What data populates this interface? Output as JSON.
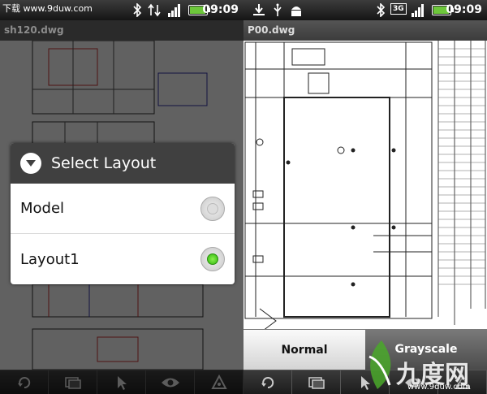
{
  "left_screen": {
    "status": {
      "time": "09:09",
      "watermark": "下载 www.9duw.com"
    },
    "title": "sh120.dwg",
    "dialog": {
      "title": "Select Layout",
      "options": [
        {
          "label": "Model",
          "selected": false
        },
        {
          "label": "Layout1",
          "selected": true
        }
      ]
    }
  },
  "right_screen": {
    "status": {
      "time": "09:09",
      "network": "3G"
    },
    "title": "P00.dwg",
    "modes": {
      "normal": "Normal",
      "grayscale": "Grayscale",
      "active": "Grayscale"
    }
  },
  "toolbar_icons": [
    "rotate-icon",
    "layers-icon",
    "pointer-icon",
    "eye-icon",
    "measure-icon"
  ],
  "logo": {
    "brand": "九度网",
    "site": "www.9duw.com"
  },
  "colors": {
    "accent_green": "#3ac21a",
    "dialog_header": "#404040",
    "battery": "#6dc73b"
  }
}
